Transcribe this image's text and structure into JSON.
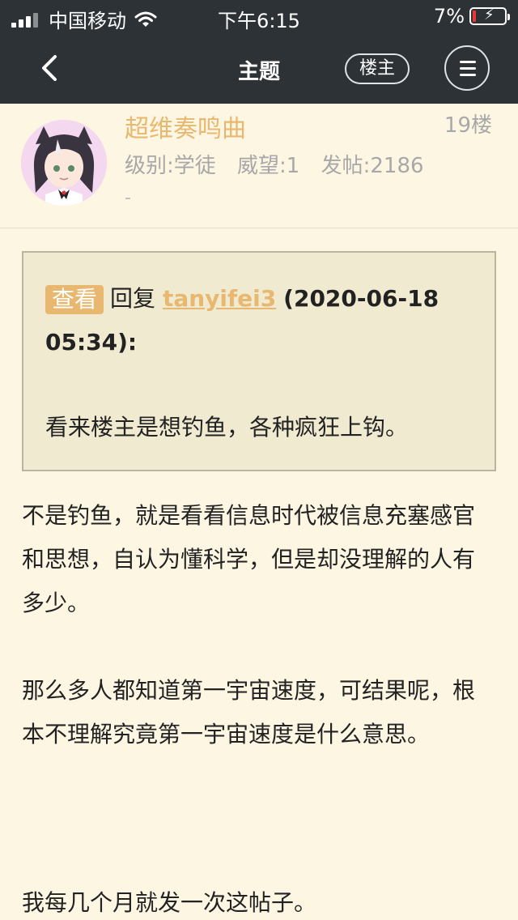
{
  "status_bar": {
    "carrier": "中国移动",
    "time": "下午6:15",
    "battery": "7%"
  },
  "nav": {
    "title": "主题",
    "owner_button": "楼主"
  },
  "post": {
    "username": "超维奏鸣曲",
    "floor": "19楼",
    "level": "级别:学徒",
    "prestige": "威望:1",
    "posts": "发帖:2186",
    "dash": "-",
    "quote": {
      "tag": "查看",
      "reply_prefix": "回复",
      "author": "tanyifei3",
      "date": "(2020-06-18 05:34):",
      "text": "看来楼主是想钓鱼，各种疯狂上钩。"
    },
    "paragraphs": [
      "不是钓鱼，就是看看信息时代被信息充塞感官和思想，自认为懂科学，但是却没理解的人有多少。",
      "那么多人都知道第一宇宙速度，可结果呢，根本不理解究竟第一宇宙速度是什么意思。",
      "我每几个月就发一次这帖子。"
    ]
  }
}
